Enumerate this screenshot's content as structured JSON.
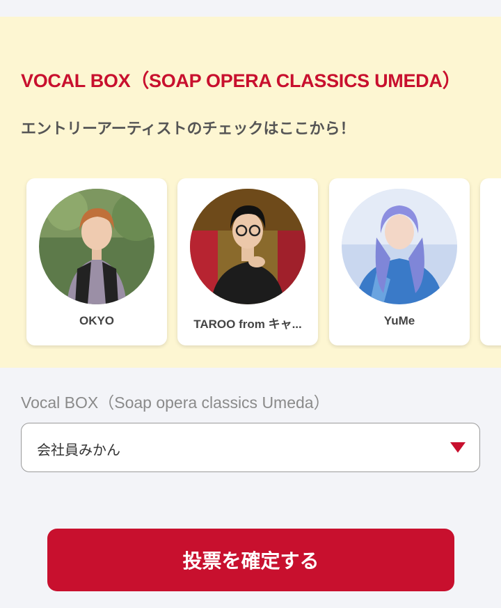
{
  "panel": {
    "title": "VOCAL BOX（SOAP OPERA CLASSICS UMEDA）",
    "subtitle": "エントリーアーティストのチェックはここから！",
    "artists": [
      {
        "name": "OKYO"
      },
      {
        "name": "TAROO from キャ..."
      },
      {
        "name": "YuMe"
      }
    ]
  },
  "vote": {
    "label": "Vocal BOX（Soap opera classics Umeda）",
    "selected": "会社員みかん",
    "confirm_label": "投票を確定する"
  },
  "colors": {
    "accent": "#c8102e",
    "panel_bg": "#fdf6d2",
    "page_bg": "#f3f4f8"
  }
}
